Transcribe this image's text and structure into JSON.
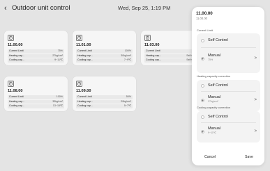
{
  "header": {
    "back_glyph": "‹",
    "title": "Outdoor unit control",
    "datetime": "Wed, Sep 25, 1:19 PM"
  },
  "cards": [
    {
      "name": "11.00.00",
      "icon": "outdoor-unit-icon",
      "rows": [
        {
          "label": "Current Limit",
          "value": "75%"
        },
        {
          "label": "Heating cap...",
          "value": "27kg/cm²"
        },
        {
          "label": "Cooling cap...",
          "value": "9~11℃"
        }
      ]
    },
    {
      "name": "11.01.00",
      "icon": "outdoor-unit-icon",
      "rows": [
        {
          "label": "Current Limit",
          "value": "100%"
        },
        {
          "label": "Heating cap...",
          "value": "30kg/cm²"
        },
        {
          "label": "Cooling cap...",
          "value": "7~9℃"
        }
      ]
    },
    {
      "name": "11.03.00",
      "icon": "outdoor-unit-icon",
      "rows": [
        {
          "label": "Current Limit",
          "value": "50%"
        },
        {
          "label": "Heating cap...",
          "value": "Self Control"
        },
        {
          "label": "Cooling cap...",
          "value": "Self Control"
        }
      ]
    },
    {
      "name": "11.08.00",
      "icon": "outdoor-unit-icon",
      "rows": [
        {
          "label": "Current Limit",
          "value": "100%"
        },
        {
          "label": "Heating cap...",
          "value": "33kg/cm²"
        },
        {
          "label": "Cooling cap...",
          "value": "13~15℃"
        }
      ]
    },
    {
      "name": "11.09.00",
      "icon": "outdoor-unit-icon",
      "rows": [
        {
          "label": "Current Limit",
          "value": "50%"
        },
        {
          "label": "Heating cap...",
          "value": "29kg/cm²"
        },
        {
          "label": "Cooling cap...",
          "value": "5~7℃"
        }
      ]
    }
  ],
  "panel": {
    "title": "11.00.00",
    "subtitle": "11.00.00",
    "sections": [
      {
        "label": "Current Limit",
        "self": "Self Control",
        "manual": "Manual",
        "manual_value": "75%",
        "selected": "manual"
      },
      {
        "label": "Heating capacity correction",
        "self": "Self Control",
        "manual": "Manual",
        "manual_value": "27kg/cm²",
        "selected": "manual"
      },
      {
        "label": "Cooling capacity correction",
        "self": "Self Control",
        "manual": "Manual",
        "manual_value": "9~11℃",
        "selected": "manual"
      }
    ],
    "cancel_label": "Cancel",
    "save_label": "Save"
  },
  "colors": {
    "background": "#ededed",
    "card": "#ffffff",
    "row": "#f2f2f2",
    "panel": "#ffffff",
    "group": "#f3f3f3"
  }
}
